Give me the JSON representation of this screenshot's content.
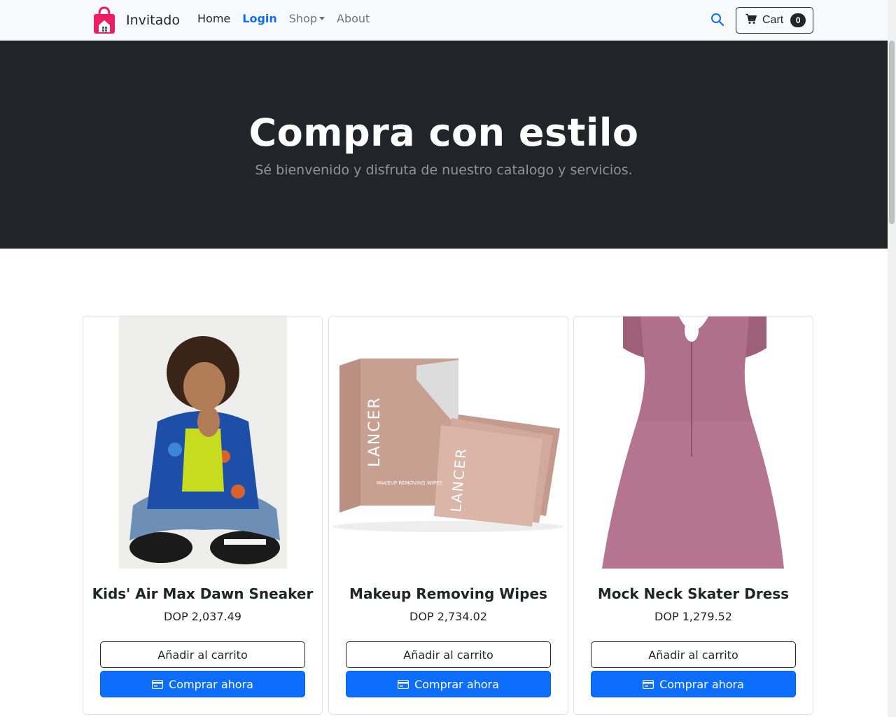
{
  "navbar": {
    "brand": "Invitado",
    "links": {
      "home": "Home",
      "login": "Login",
      "shop": "Shop",
      "about": "About"
    },
    "cart_label": "Cart",
    "cart_count": "0"
  },
  "hero": {
    "title": "Compra con estilo",
    "subtitle": "Sé bienvenido y disfruta de nuestro catalogo y servicios."
  },
  "products": [
    {
      "name": "Kids' Air Max Dawn Sneaker",
      "price": "DOP 2,037.49",
      "add_label": "Añadir al carrito",
      "buy_label": "Comprar ahora"
    },
    {
      "name": "Makeup Removing Wipes",
      "price": "DOP 2,734.02",
      "add_label": "Añadir al carrito",
      "buy_label": "Comprar ahora",
      "package_brand": "LANCER",
      "package_text": "MAKEUP REMOVING WIPES"
    },
    {
      "name": "Mock Neck Skater Dress",
      "price": "DOP 1,279.52",
      "add_label": "Añadir al carrito",
      "buy_label": "Comprar ahora"
    }
  ],
  "colors": {
    "navbar_bg": "#f8f9fa",
    "hero_bg": "#212529",
    "primary": "#0d6efd",
    "brand_pink": "#e91e63"
  }
}
